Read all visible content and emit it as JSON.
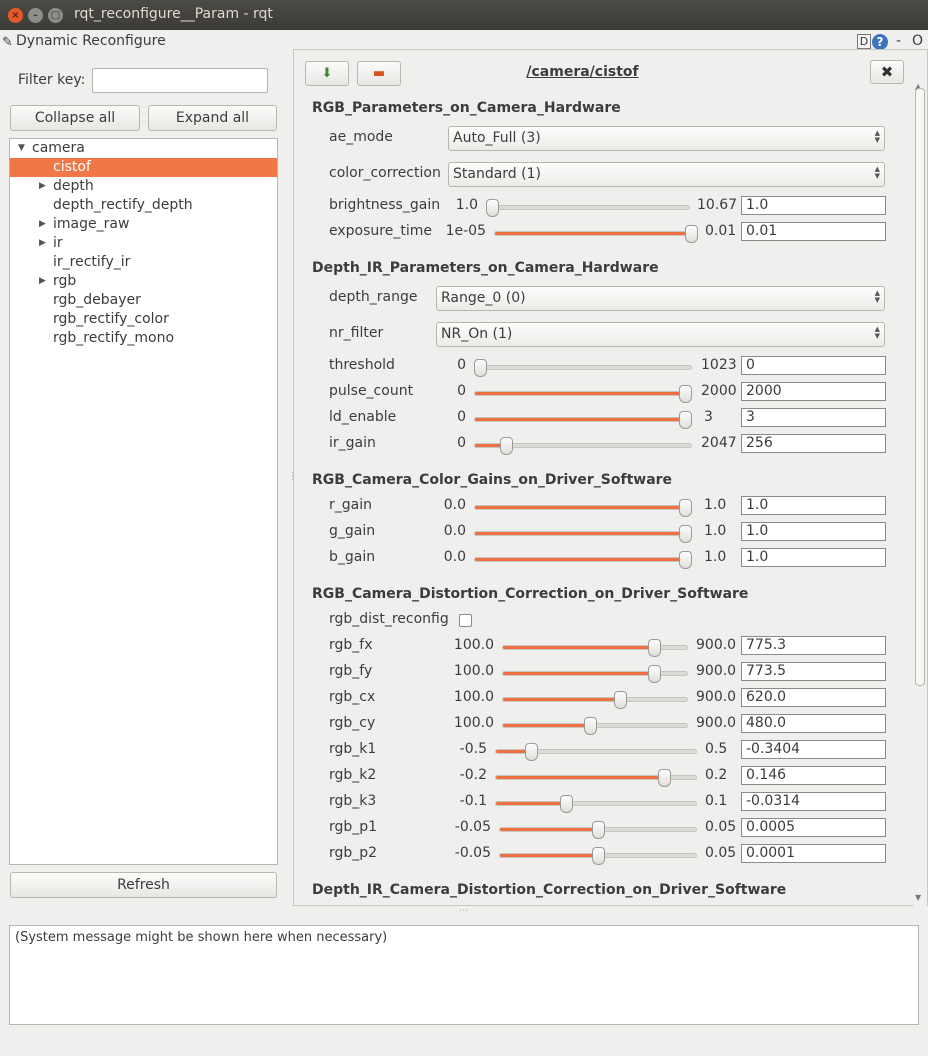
{
  "window": {
    "title": "rqt_reconfigure__Param - rqt",
    "close": "×",
    "min": "–",
    "max": "□"
  },
  "plugin": {
    "icon": "✎",
    "title": "Dynamic Reconfigure",
    "d_label": "D",
    "help_label": "?",
    "dash": "-",
    "o": "O"
  },
  "filter": {
    "label": "Filter key:",
    "value": ""
  },
  "buttons": {
    "collapse": "Collapse all",
    "expand": "Expand all",
    "refresh": "Refresh"
  },
  "tree": [
    {
      "label": "camera",
      "level": 0,
      "arrow": "▼",
      "selected": false
    },
    {
      "label": "cistof",
      "level": 1,
      "arrow": "",
      "selected": true
    },
    {
      "label": "depth",
      "level": 1,
      "arrow": "▶",
      "selected": false
    },
    {
      "label": "depth_rectify_depth",
      "level": 1,
      "arrow": "",
      "selected": false
    },
    {
      "label": "image_raw",
      "level": 1,
      "arrow": "▶",
      "selected": false
    },
    {
      "label": "ir",
      "level": 1,
      "arrow": "▶",
      "selected": false
    },
    {
      "label": "ir_rectify_ir",
      "level": 1,
      "arrow": "",
      "selected": false
    },
    {
      "label": "rgb",
      "level": 1,
      "arrow": "▶",
      "selected": false
    },
    {
      "label": "rgb_debayer",
      "level": 1,
      "arrow": "",
      "selected": false
    },
    {
      "label": "rgb_rectify_color",
      "level": 1,
      "arrow": "",
      "selected": false
    },
    {
      "label": "rgb_rectify_mono",
      "level": 1,
      "arrow": "",
      "selected": false
    }
  ],
  "node": {
    "title": "/camera/cistof",
    "save_icon": "⬇",
    "load_icon": "▬",
    "close_icon": "✖"
  },
  "groups": [
    {
      "title": "RGB_Parameters_on_Camera_Hardware"
    },
    {
      "title": "Depth_IR_Parameters_on_Camera_Hardware"
    },
    {
      "title": "RGB_Camera_Color_Gains_on_Driver_Software"
    },
    {
      "title": "RGB_Camera_Distortion_Correction_on_Driver_Software"
    },
    {
      "title": "Depth_IR_Camera_Distortion_Correction_on_Driver_Software"
    }
  ],
  "combos": [
    {
      "name": "ae_mode",
      "value": "Auto_Full (3)"
    },
    {
      "name": "color_correction",
      "value": "Standard (1)"
    },
    {
      "name": "depth_range",
      "value": "Range_0 (0)"
    },
    {
      "name": "nr_filter",
      "value": "NR_On (1)"
    }
  ],
  "sliders": [
    {
      "name": "brightness_gain",
      "min": "1.0",
      "max": "10.67",
      "value": "1.0",
      "fraction": 0.0
    },
    {
      "name": "exposure_time",
      "min": "1e-05",
      "max": "0.01",
      "value": "0.01",
      "fraction": 1.0
    },
    {
      "name": "threshold",
      "min": "0",
      "max": "1023",
      "value": "0",
      "fraction": 0.0
    },
    {
      "name": "pulse_count",
      "min": "0",
      "max": "2000",
      "value": "2000",
      "fraction": 1.0
    },
    {
      "name": "ld_enable",
      "min": "0",
      "max": "3",
      "value": "3",
      "fraction": 1.0
    },
    {
      "name": "ir_gain",
      "min": "0",
      "max": "2047",
      "value": "256",
      "fraction": 0.125
    },
    {
      "name": "r_gain",
      "min": "0.0",
      "max": "1.0",
      "value": "1.0",
      "fraction": 1.0
    },
    {
      "name": "g_gain",
      "min": "0.0",
      "max": "1.0",
      "value": "1.0",
      "fraction": 1.0
    },
    {
      "name": "b_gain",
      "min": "0.0",
      "max": "1.0",
      "value": "1.0",
      "fraction": 1.0
    },
    {
      "name": "rgb_fx",
      "min": "100.0",
      "max": "900.0",
      "value": "775.3",
      "fraction": 0.844
    },
    {
      "name": "rgb_fy",
      "min": "100.0",
      "max": "900.0",
      "value": "773.5",
      "fraction": 0.842
    },
    {
      "name": "rgb_cx",
      "min": "100.0",
      "max": "900.0",
      "value": "620.0",
      "fraction": 0.65
    },
    {
      "name": "rgb_cy",
      "min": "100.0",
      "max": "900.0",
      "value": "480.0",
      "fraction": 0.475
    },
    {
      "name": "rgb_k1",
      "min": "-0.5",
      "max": "0.5",
      "value": "-0.3404",
      "fraction": 0.16
    },
    {
      "name": "rgb_k2",
      "min": "-0.2",
      "max": "0.2",
      "value": "0.146",
      "fraction": 0.865
    },
    {
      "name": "rgb_k3",
      "min": "-0.1",
      "max": "0.1",
      "value": "-0.0314",
      "fraction": 0.343
    },
    {
      "name": "rgb_p1",
      "min": "-0.05",
      "max": "0.05",
      "value": "0.0005",
      "fraction": 0.505
    },
    {
      "name": "rgb_p2",
      "min": "-0.05",
      "max": "0.05",
      "value": "0.0001",
      "fraction": 0.501
    }
  ],
  "checkboxes": [
    {
      "name": "rgb_dist_reconfig",
      "checked": false
    }
  ],
  "status": {
    "message": "(System message might be shown here when necessary)"
  }
}
